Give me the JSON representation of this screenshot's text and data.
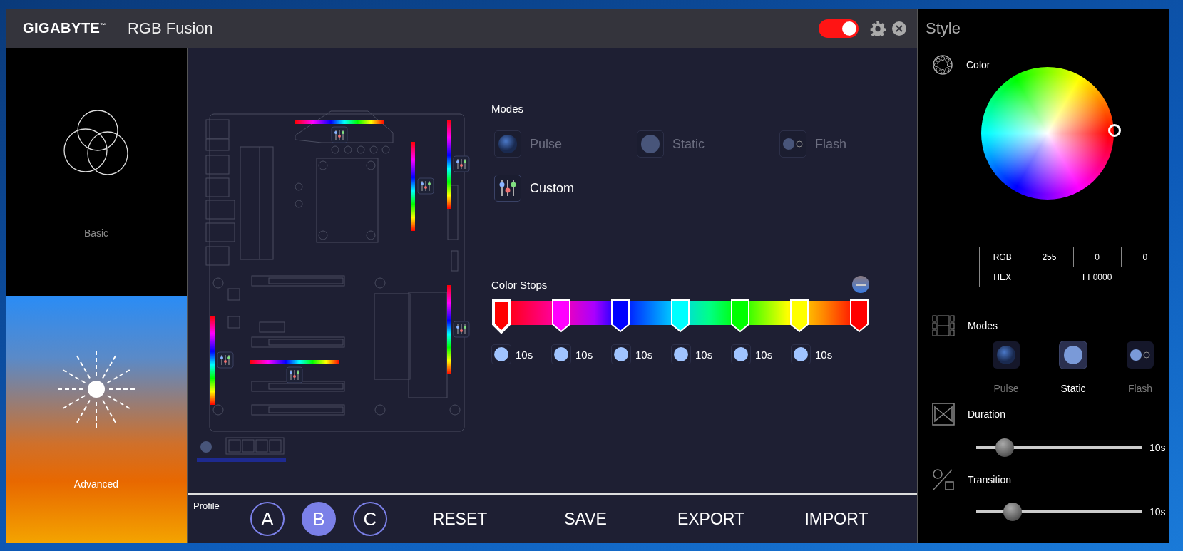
{
  "header": {
    "logo": "GIGABYTE$^{™}$",
    "app_title": "RGB Fusion",
    "power_on": true
  },
  "sidebar": {
    "items": [
      {
        "label": "Basic",
        "kind": "basic",
        "selected": false
      },
      {
        "label": "Advanced",
        "kind": "advanced",
        "selected": true
      }
    ]
  },
  "modes": {
    "title": "Modes",
    "items": [
      {
        "label": "Pulse",
        "kind": "pulse",
        "disabled": true
      },
      {
        "label": "Static",
        "kind": "static",
        "disabled": true
      },
      {
        "label": "Flash",
        "kind": "flash",
        "disabled": true
      },
      {
        "label": "Custom",
        "kind": "custom",
        "disabled": false
      }
    ]
  },
  "color_stops": {
    "title": "Color Stops",
    "markers": [
      {
        "color": "#ff0000",
        "selected": true
      },
      {
        "color": "#ff00ff",
        "selected": false
      },
      {
        "color": "#0000ff",
        "selected": false
      },
      {
        "color": "#00ffff",
        "selected": false
      },
      {
        "color": "#00ff00",
        "selected": false
      },
      {
        "color": "#ffff00",
        "selected": false
      },
      {
        "color": "#ff0000",
        "selected": false
      }
    ],
    "durations": [
      "10s",
      "10s",
      "10s",
      "10s",
      "10s",
      "10s"
    ]
  },
  "profile": {
    "label": "Profile",
    "slots": [
      {
        "label": "A",
        "selected": false
      },
      {
        "label": "B",
        "selected": true
      },
      {
        "label": "C",
        "selected": false
      }
    ]
  },
  "actions": [
    "RESET",
    "SAVE",
    "EXPORT",
    "IMPORT"
  ],
  "style_panel": {
    "title": "Style",
    "color_label": "Color",
    "rgb_label": "RGB",
    "rgb": [
      "255",
      "0",
      "0"
    ],
    "hex_label": "HEX",
    "hex": "FF0000",
    "modes_label": "Modes",
    "modes": [
      {
        "label": "Pulse",
        "kind": "pulse",
        "selected": false
      },
      {
        "label": "Static",
        "kind": "static",
        "selected": true
      },
      {
        "label": "Flash",
        "kind": "flash",
        "selected": false
      }
    ],
    "sliders": [
      {
        "label": "Duration",
        "kind": "duration",
        "level": 0.17,
        "reading": "10s"
      },
      {
        "label": "Transition",
        "kind": "transition",
        "level": 0.22,
        "reading": "10s"
      }
    ]
  }
}
